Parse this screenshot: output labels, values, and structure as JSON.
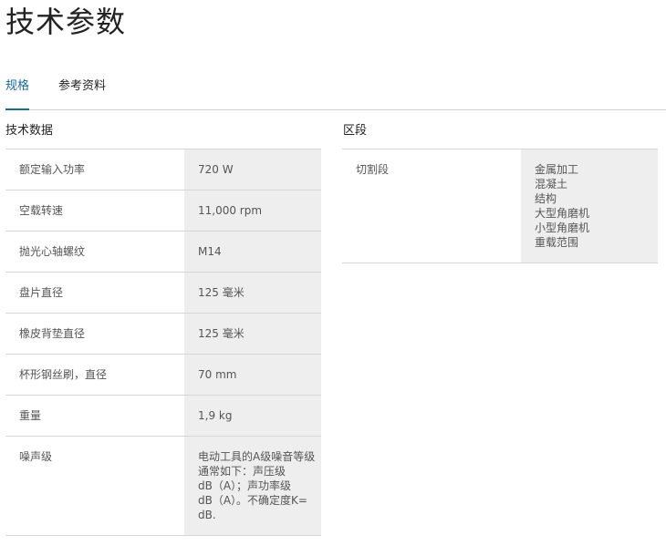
{
  "page": {
    "title": "技术参数"
  },
  "tabs": [
    {
      "label": "规格",
      "active": true
    },
    {
      "label": "参考资料",
      "active": false
    }
  ],
  "tech_data": {
    "title": "技术数据",
    "rows": [
      {
        "label": "额定输入功率",
        "value": [
          "720 W"
        ]
      },
      {
        "label": "空载转速",
        "value": [
          "11,000 rpm"
        ]
      },
      {
        "label": "抛光心轴螺纹",
        "value": [
          "M14"
        ]
      },
      {
        "label": "盘片直径",
        "value": [
          "125 毫米"
        ]
      },
      {
        "label": "橡皮背垫直径",
        "value": [
          "125 毫米"
        ]
      },
      {
        "label": "杯形钢丝刷，直径",
        "value": [
          "70 mm"
        ]
      },
      {
        "label": "重量",
        "value": [
          "1,9 kg"
        ]
      },
      {
        "label": "噪声级",
        "value": [
          "电动工具的A级噪音等级",
          "通常如下：声压级",
          "dB（A）；声功率级",
          "dB（A）。不确定度K=",
          "dB."
        ]
      }
    ]
  },
  "segments": {
    "title": "区段",
    "rows": [
      {
        "label": "切割段",
        "value": [
          "金属加工",
          "混凝土",
          "结构",
          "大型角磨机",
          "小型角磨机",
          "重载范围"
        ]
      }
    ]
  },
  "colors": {
    "accent": "#1a6a9e",
    "value_bg": "#eeeeee",
    "border": "#d6d6d6"
  }
}
